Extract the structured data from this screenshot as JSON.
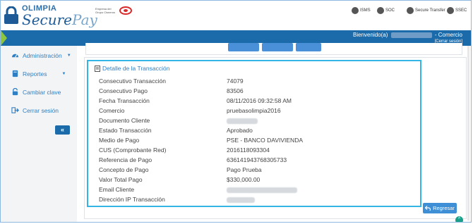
{
  "header": {
    "brand_small": "OLIMPIA",
    "brand_secure": "Secure",
    "brand_pay": "Pay",
    "group_text": "Empresa del Grupo Cisneros",
    "certs": [
      {
        "label": "ISMS",
        "icon": "isms-cert-icon"
      },
      {
        "label": "SOC",
        "icon": "soc-cert-icon"
      },
      {
        "label": "Secure Transfer",
        "icon": "secure-transfer-cert-icon"
      },
      {
        "label": "SSEC",
        "icon": "ssec-cert-icon"
      }
    ]
  },
  "topbar": {
    "welcome_prefix": "Bienvenido(a)",
    "welcome_suffix": "- Comercio",
    "logout": "[Cerrar sesión]"
  },
  "sidebar": {
    "items": [
      {
        "label": "Administración",
        "icon": "dashboard-icon",
        "caret": true
      },
      {
        "label": "Reportes",
        "icon": "book-icon",
        "caret": true
      },
      {
        "label": "Cambiar clave",
        "icon": "unlock-icon",
        "caret": false
      },
      {
        "label": "Cerrar sesión",
        "icon": "sign-out-icon",
        "caret": false
      }
    ],
    "collapse_label": "«"
  },
  "detail": {
    "title": "Detalle de la Transacción",
    "rows": [
      {
        "label": "Consecutivo Transacción",
        "value": "74079"
      },
      {
        "label": "Consecutivo Pago",
        "value": "83506"
      },
      {
        "label": "Fecha Transacción",
        "value": "08/11/2016 09:32:58 AM"
      },
      {
        "label": "Comercio",
        "value": "pruebasolimpia2016"
      },
      {
        "label": "Documento Cliente",
        "value": ""
      },
      {
        "label": "Estado Transacción",
        "value": "Aprobado"
      },
      {
        "label": "Medio de Pago",
        "value": "PSE - BANCO DAVIVIENDA"
      },
      {
        "label": "CUS (Comprobante Red)",
        "value": "2016118093304"
      },
      {
        "label": "Referencia de Pago",
        "value": "636141943768305733"
      },
      {
        "label": "Concepto de Pago",
        "value": "Pago Prueba"
      },
      {
        "label": "Valor Total Pago",
        "value": "$330,000.00"
      },
      {
        "label": "Email Cliente",
        "value": ""
      },
      {
        "label": "Dirección IP Transacción",
        "value": ""
      }
    ]
  },
  "actions": {
    "back_label": "Regresar",
    "scroll_top": "^"
  },
  "colors": {
    "primary": "#1b6aa9",
    "accent_green": "#8ec63f",
    "link": "#2f7fc4",
    "highlight_border": "#33b5e5"
  }
}
